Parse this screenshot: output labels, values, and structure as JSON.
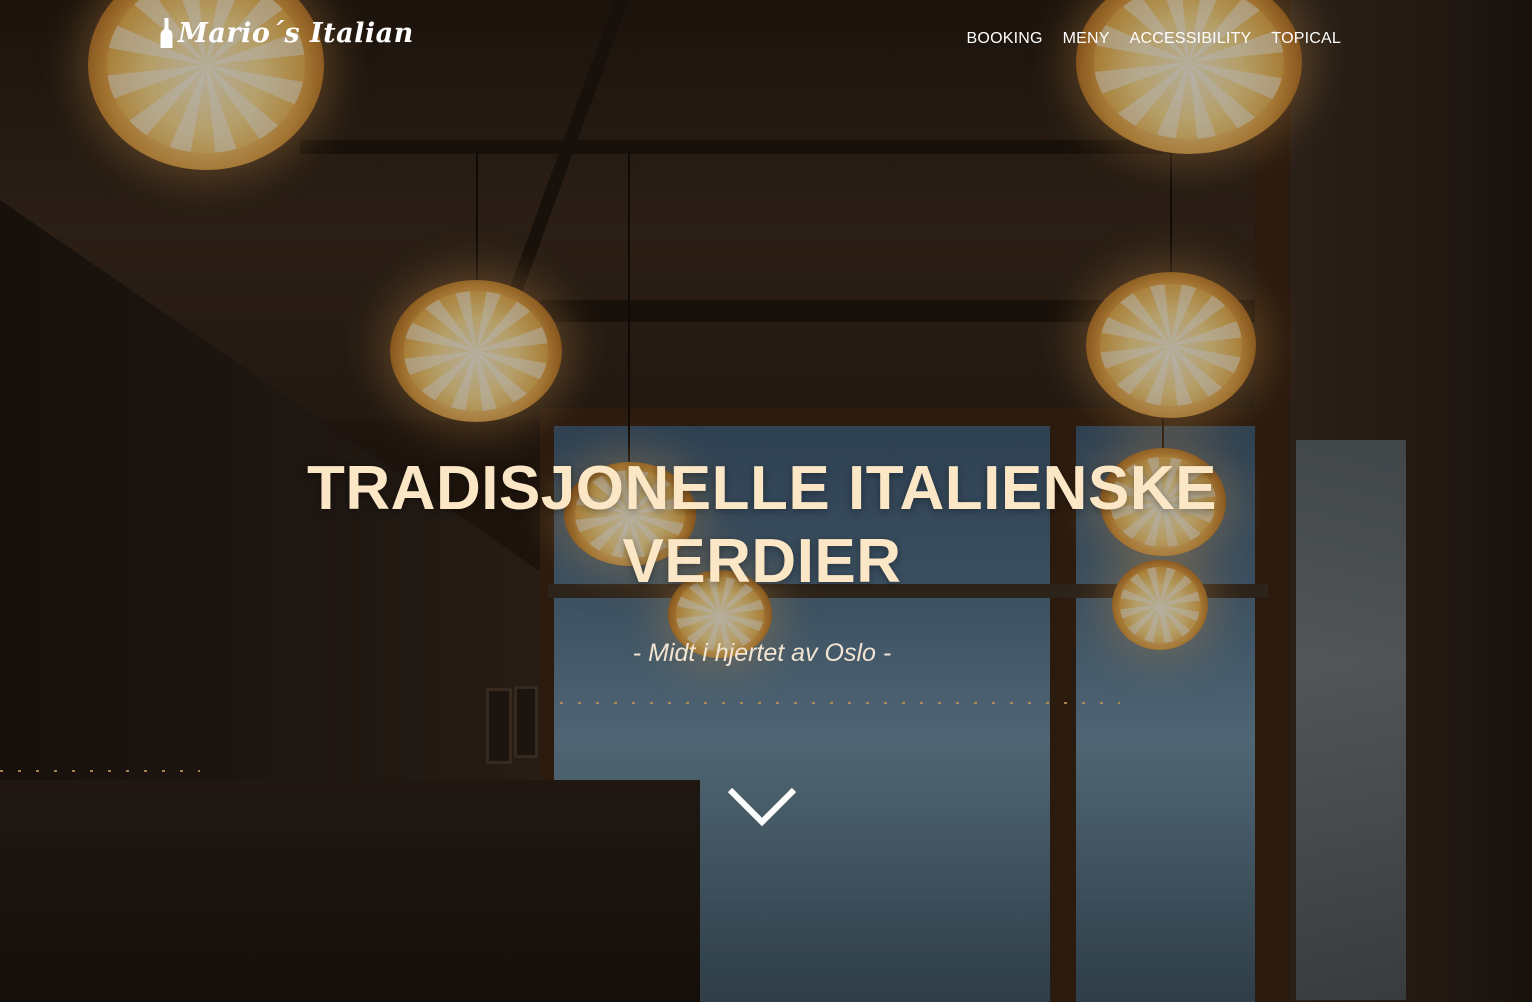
{
  "brand": {
    "logo_text": "Mario´s Italian",
    "logo_icon": "wine-bottle-icon"
  },
  "nav": {
    "items": [
      {
        "label": "BOOKING"
      },
      {
        "label": "MENY"
      },
      {
        "label": "ACCESSIBILITY"
      },
      {
        "label": "TOPICAL"
      }
    ]
  },
  "hero": {
    "title": "TRADISJONELLE ITALIENSKE VERDIER",
    "subtitle": "- Midt i hjertet av Oslo -",
    "scroll_icon": "chevron-down-icon"
  },
  "colors": {
    "title": "#fbe6c6",
    "subtitle": "#f1e4d2",
    "nav_text": "#ffffff"
  }
}
